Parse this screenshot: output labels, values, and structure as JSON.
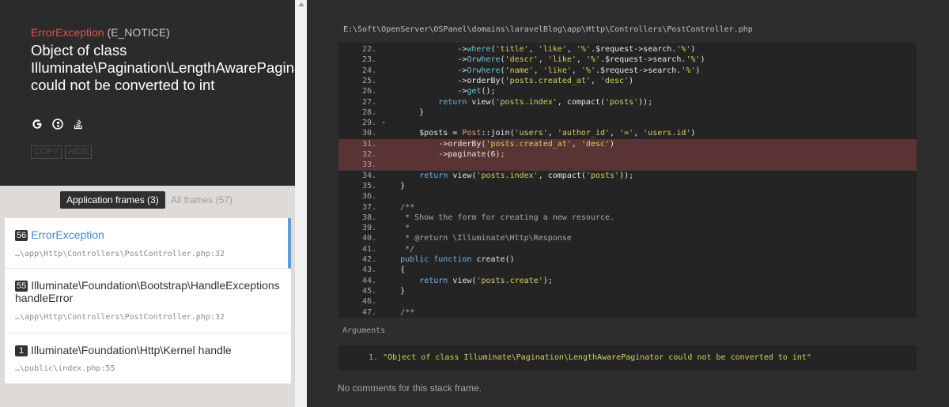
{
  "exception": {
    "class": "ErrorException",
    "type": "(E_NOTICE)",
    "message": "Object of class Illuminate\\Pagination\\LengthAwarePaginator could not be converted to int"
  },
  "search_icons": [
    "google-icon",
    "duckduckgo-icon",
    "stackoverflow-icon"
  ],
  "header_buttons": {
    "copy": "COPY",
    "hide": "HIDE"
  },
  "frames_tabs": {
    "application": "Application frames (3)",
    "all": "All frames (57)"
  },
  "frames": [
    {
      "num": "56",
      "title": "ErrorException",
      "file": "…\\app\\Http\\Controllers\\PostController.php:32"
    },
    {
      "num": "55",
      "title": "Illuminate\\Foundation\\Bootstrap\\HandleExceptions handleError",
      "file": "…\\app\\Http\\Controllers\\PostController.php:32"
    },
    {
      "num": "1",
      "title": "Illuminate\\Foundation\\Http\\Kernel handle",
      "file": "…\\public\\index.php:55"
    }
  ],
  "code": {
    "file_path": "E:\\Soft\\OpenServer\\OSPanel\\domains\\laravelBlog\\app\\Http\\Controllers\\PostController.php",
    "highlight_lines": [
      "31.",
      "32.",
      "33."
    ],
    "lines": [
      {
        "n": "22.",
        "t": "                ->where('title', 'like', '%'.$request->search.'%')"
      },
      {
        "n": "23.",
        "t": "                ->Orwhere('descr', 'like', '%'.$request->search.'%')"
      },
      {
        "n": "24.",
        "t": "                ->Orwhere('name', 'like', '%'.$request->search.'%')"
      },
      {
        "n": "25.",
        "t": "                ->orderBy('posts.created_at', 'desc')"
      },
      {
        "n": "26.",
        "t": "                ->get();"
      },
      {
        "n": "27.",
        "t": "            return view('posts.index', compact('posts'));"
      },
      {
        "n": "28.",
        "t": "        }"
      },
      {
        "n": "29.",
        "t": "-"
      },
      {
        "n": "30.",
        "t": "        $posts = Post::join('users', 'author_id', '=', 'users.id')"
      },
      {
        "n": "31.",
        "t": "            ->orderBy('posts.created_at', 'desc')"
      },
      {
        "n": "32.",
        "t": "            ->paginate(6);"
      },
      {
        "n": "33.",
        "t": ""
      },
      {
        "n": "34.",
        "t": "        return view('posts.index', compact('posts'));"
      },
      {
        "n": "35.",
        "t": "    }"
      },
      {
        "n": "36.",
        "t": ""
      },
      {
        "n": "37.",
        "t": "    /**"
      },
      {
        "n": "38.",
        "t": "     * Show the form for creating a new resource."
      },
      {
        "n": "39.",
        "t": "     *"
      },
      {
        "n": "40.",
        "t": "     * @return \\Illuminate\\Http\\Response"
      },
      {
        "n": "41.",
        "t": "     */"
      },
      {
        "n": "42.",
        "t": "    public function create()"
      },
      {
        "n": "43.",
        "t": "    {"
      },
      {
        "n": "44.",
        "t": "        return view('posts.create');"
      },
      {
        "n": "45.",
        "t": "    }"
      },
      {
        "n": "46.",
        "t": ""
      },
      {
        "n": "47.",
        "t": "    /**"
      }
    ]
  },
  "arguments": {
    "label": "Arguments",
    "items": [
      {
        "idx": "1.",
        "value": "\"Object of class Illuminate\\Pagination\\LengthAwarePaginator could not be converted to int\""
      }
    ]
  },
  "comments": "No comments for this stack frame.",
  "colors": {
    "accent": "#5e9cd6",
    "error": "#e25151",
    "highlight": "#5a3434"
  }
}
